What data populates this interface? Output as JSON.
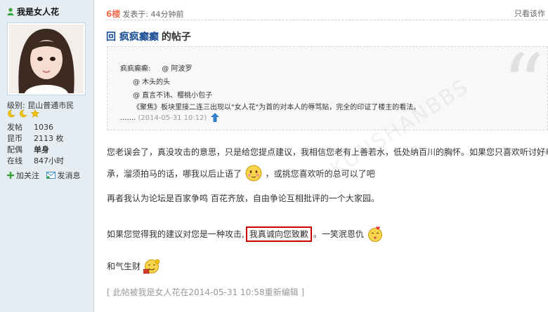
{
  "user": {
    "name": "我是女人花",
    "rank_label": "级别: ",
    "rank": "昆山普通市民",
    "stats": [
      {
        "label": "发帖",
        "value": "1036",
        "bold": false
      },
      {
        "label": "昆币",
        "value": "2113 枚",
        "bold": false
      },
      {
        "label": "配偶",
        "value": "单身",
        "bold": true
      },
      {
        "label": "在线",
        "value": "847小时",
        "bold": false
      }
    ],
    "actions": {
      "follow": "加关注",
      "message": "发消息"
    }
  },
  "post": {
    "floor": "6楼",
    "posted_at": "发表于: 44分钟前",
    "author_only": "只看该作",
    "title_prefix": "回",
    "title_user": "疯疯癫癫",
    "title_suffix": "的帖子",
    "quote": {
      "line1_user": "疯疯癫癫:",
      "line1_at": "@ 阿波罗",
      "line2": "@ 木头的头",
      "line3": "@ 直言不讳、樱桃小包子",
      "line4": "《聚焦》板块里接二连三出现以\"女人花\"为首的对本人的辱骂贴，完全的印证了楼主的看法。",
      "time_prefix": ".......",
      "time": "(2014-05-31 10:12)"
    },
    "para1a": "您老误会了，真没攻击的意思，只是给您提点建议，我相信您老有上善若水，低处纳百川的胸怀。如果您只喜欢听讨好奉",
    "para1b_start": "承，溜须拍马的话，哪我以后止语了",
    "para1b_end": "，或挑您喜欢听的总可以了吧",
    "para2": "再者我认为论坛是百家争鸣 百花齐放，自由争论互相批评的一个大家园。",
    "para3_start": "如果您觉得我的建议对您是一种攻击,",
    "para3_highlight": "我真诚向您致歉",
    "para3_end": "。一笑泯恩仇",
    "para4": "和气生财",
    "edit_note": "[ 此帖被我是女人花在2014-05-31 10:58重新编辑 ]",
    "watermark": "KUNSHANBBS"
  },
  "colors": {
    "sidebar_bg": "#e5edf2",
    "floor": "#f26c4f",
    "title_link": "#1a4e94",
    "highlight_border": "#c80000",
    "muted": "#999999"
  },
  "icons": {
    "user": "user-icon",
    "medal": "moon-star-medal-icon",
    "follow": "plus-icon",
    "message": "envelope-icon",
    "quote_back": "up-arrow-icon",
    "emoticons": [
      "shy-face-icon",
      "kiss-face-icon",
      "money-face-icon"
    ]
  }
}
